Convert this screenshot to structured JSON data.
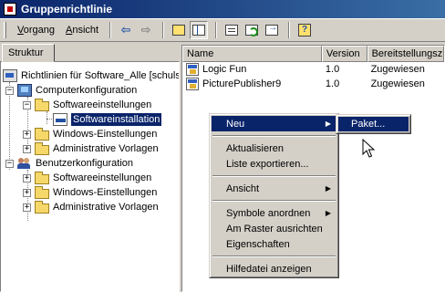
{
  "window": {
    "title": "Gruppenrichtlinie"
  },
  "toolbar": {
    "menu_action": "Vorgang",
    "menu_action_hotkey": "V",
    "menu_action_rest": "organg",
    "menu_view": "Ansicht",
    "menu_view_hotkey": "A",
    "menu_view_rest": "nsicht"
  },
  "left_pane": {
    "tab_label": "Struktur",
    "tree": {
      "root": "Richtlinien für Software_Alle [schuls",
      "computer_config": "Computerkonfiguration",
      "computer_software_settings": "Softwareeinstellungen",
      "software_installation": "Softwareinstallation",
      "computer_windows_settings": "Windows-Einstellungen",
      "computer_admin_templates": "Administrative Vorlagen",
      "user_config": "Benutzerkonfiguration",
      "user_software_settings": "Softwareeinstellungen",
      "user_windows_settings": "Windows-Einstellungen",
      "user_admin_templates": "Administrative Vorlagen"
    }
  },
  "list": {
    "columns": [
      "Name",
      "Version",
      "Bereitstellungsz..."
    ],
    "rows": [
      {
        "name": "Logic Fun",
        "version": "1.0",
        "deployment": "Zugewiesen"
      },
      {
        "name": "PicturePublisher9",
        "version": "1.0",
        "deployment": "Zugewiesen"
      }
    ]
  },
  "context_menu": {
    "new": "Neu",
    "refresh": "Aktualisieren",
    "export_list": "Liste exportieren...",
    "view": "Ansicht",
    "arrange_icons": "Symbole anordnen",
    "line_up": "Am Raster ausrichten",
    "properties": "Eigenschaften",
    "help": "Hilfedatei anzeigen"
  },
  "submenu": {
    "package": "Paket..."
  },
  "colors": {
    "selection": "#0a246a",
    "window_bg": "#d4d0c8"
  },
  "icons": [
    "app-icon",
    "back-arrow-icon",
    "forward-arrow-icon",
    "up-folder-icon",
    "show-tree-icon",
    "properties-icon",
    "refresh-icon",
    "export-list-icon",
    "help-icon",
    "computer-icon",
    "users-icon",
    "folder-icon",
    "package-icon",
    "mouse-cursor-icon"
  ]
}
